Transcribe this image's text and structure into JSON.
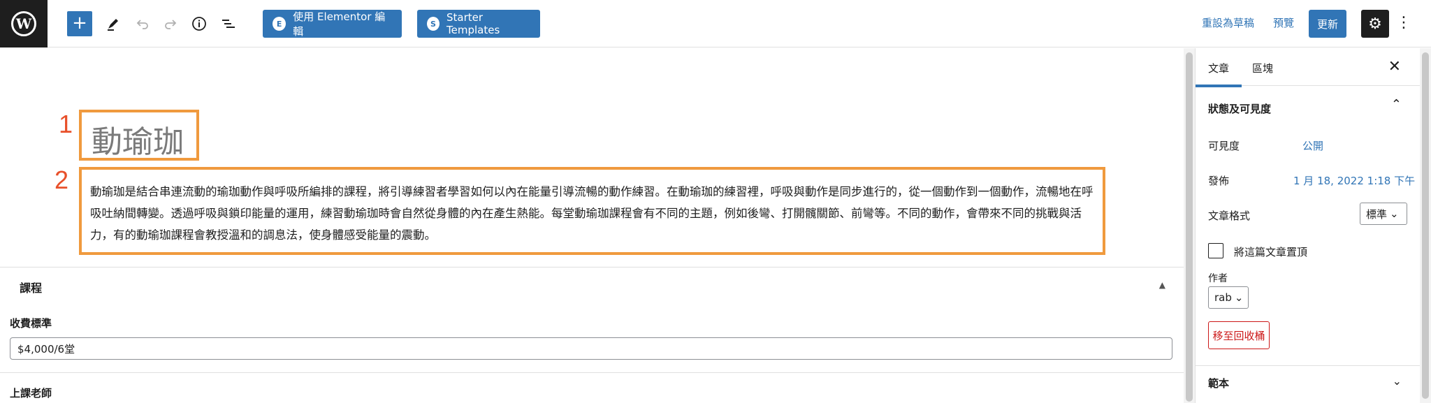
{
  "toolbar": {
    "logo_letter": "W",
    "add_symbol": "+",
    "elementor_label": "使用 Elementor 編輯",
    "starter_label": "Starter Templates",
    "revert_label": "重設為草稿",
    "preview_label": "預覽",
    "update_label": "更新",
    "settings_symbol": "⚙",
    "more_symbol": "⋮"
  },
  "annotations": {
    "n1": "1",
    "n2": "2"
  },
  "post": {
    "title": "動瑜珈",
    "paragraph": "動瑜珈是結合串連流動的瑜珈動作與呼吸所編排的課程，將引導練習者學習如何以內在能量引導流暢的動作練習。在動瑜珈的練習裡，呼吸與動作是同步進行的，從一個動作到一個動作，流暢地在呼吸吐納間轉變。透過呼吸與鎖印能量的運用，練習動瑜珈時會自然從身體的內在產生熱能。每堂動瑜珈課程會有不同的主題，例如後彎、打開髖關節、前彎等。不同的動作，會帶來不同的挑戰與活力，有的動瑜珈課程會教授溫和的調息法，使身體感受能量的震動。"
  },
  "meta": {
    "box_title": "課程",
    "fee_label": "收費標準",
    "fee_value": "$4,000/6堂",
    "teacher_label": "上課老師"
  },
  "sidebar": {
    "tab_post": "文章",
    "tab_block": "區塊",
    "close_symbol": "✕",
    "panel_title": "狀態及可見度",
    "visibility_label": "可見度",
    "visibility_value": "公開",
    "publish_label": "發佈",
    "publish_value": "1 月 18, 2022 1:18 下午",
    "format_label": "文章格式",
    "format_value": "標準",
    "sticky_label": "將這篇文章置頂",
    "author_label": "作者",
    "author_value": "rab",
    "trash_label": "移至回收桶",
    "template_title": "範本"
  },
  "colors": {
    "accent": "#3175b6",
    "highlight": "#f09a3e",
    "annotation": "#e8502a",
    "danger": "#cc1818"
  }
}
